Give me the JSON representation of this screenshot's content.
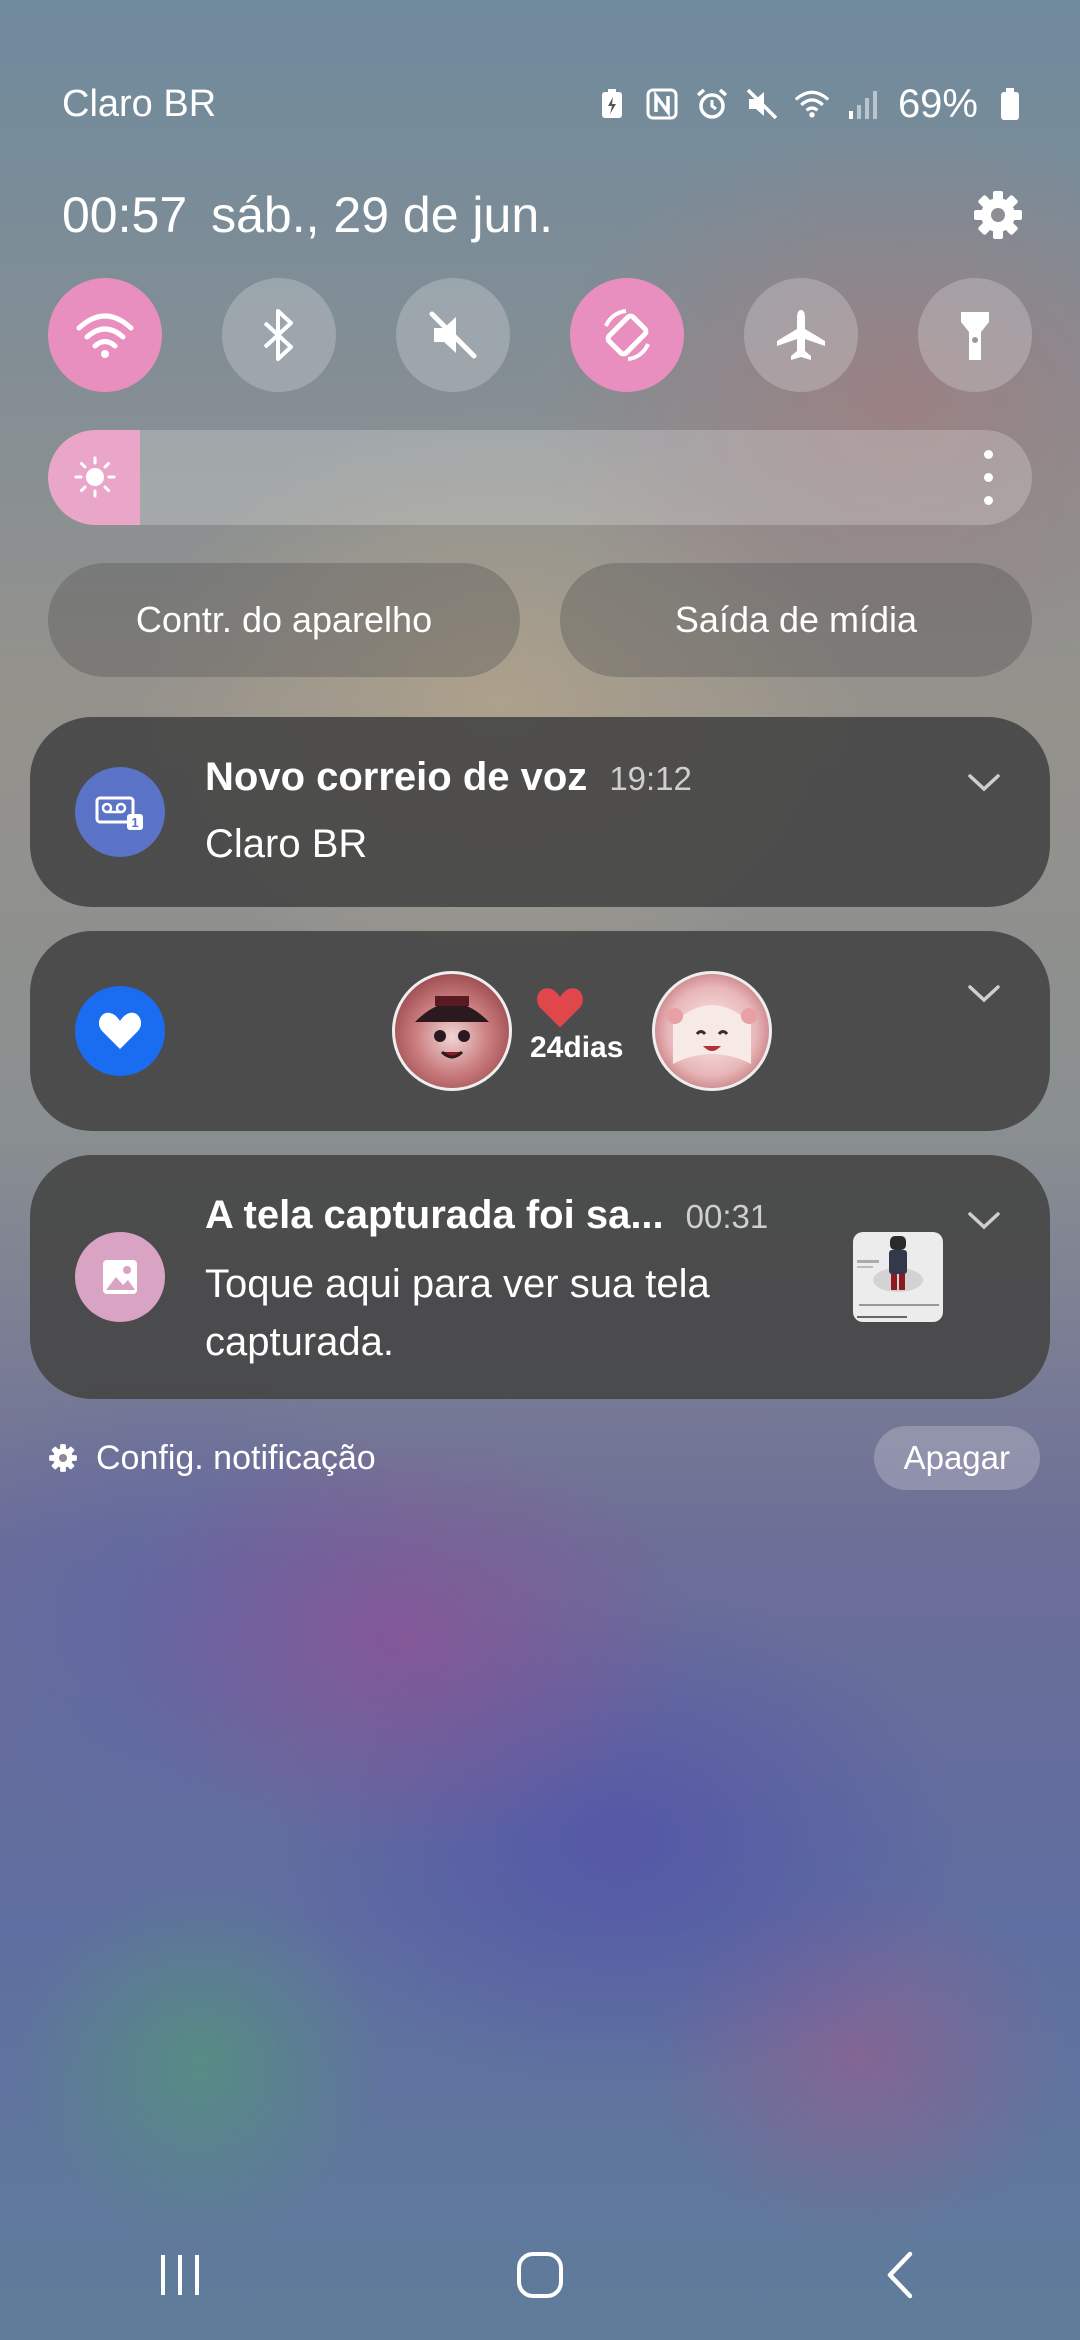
{
  "status_bar": {
    "carrier": "Claro BR",
    "battery": "69%",
    "icons": [
      "battery-saver-icon",
      "nfc-icon",
      "alarm-icon",
      "mute-icon",
      "wifi-icon",
      "signal-icon",
      "battery-icon"
    ]
  },
  "header": {
    "time": "00:57",
    "date": "sáb., 29 de jun."
  },
  "quick_tiles": [
    {
      "name": "wifi-tile",
      "icon": "wifi-icon",
      "active": true
    },
    {
      "name": "bluetooth-tile",
      "icon": "bluetooth-icon",
      "active": false
    },
    {
      "name": "sound-tile",
      "icon": "mute-icon",
      "active": false
    },
    {
      "name": "auto-rotate-tile",
      "icon": "rotate-icon",
      "active": true
    },
    {
      "name": "airplane-tile",
      "icon": "airplane-icon",
      "active": false
    },
    {
      "name": "flashlight-tile",
      "icon": "flashlight-icon",
      "active": false
    }
  ],
  "brightness": {
    "level_percent": 9
  },
  "buttons": {
    "device_control": "Contr. do aparelho",
    "media_output": "Saída de mídia"
  },
  "notifications": {
    "voicemail": {
      "title": "Novo correio de voz",
      "time": "19:12",
      "text": "Claro BR"
    },
    "couple": {
      "days": "24dias"
    },
    "screenshot": {
      "title": "A tela capturada foi sa...",
      "time": "00:31",
      "text_line1": "Toque aqui para ver sua tela",
      "text_line2": "capturada."
    }
  },
  "footer": {
    "settings_label": "Config. notificação",
    "clear_label": "Apagar"
  },
  "colors": {
    "active_tile": "#e98fc0",
    "voicemail_icon": "#5b73c7",
    "couple_icon": "#1a6cf0",
    "screenshot_icon": "#d9a3c3",
    "heart": "#e0474c"
  }
}
